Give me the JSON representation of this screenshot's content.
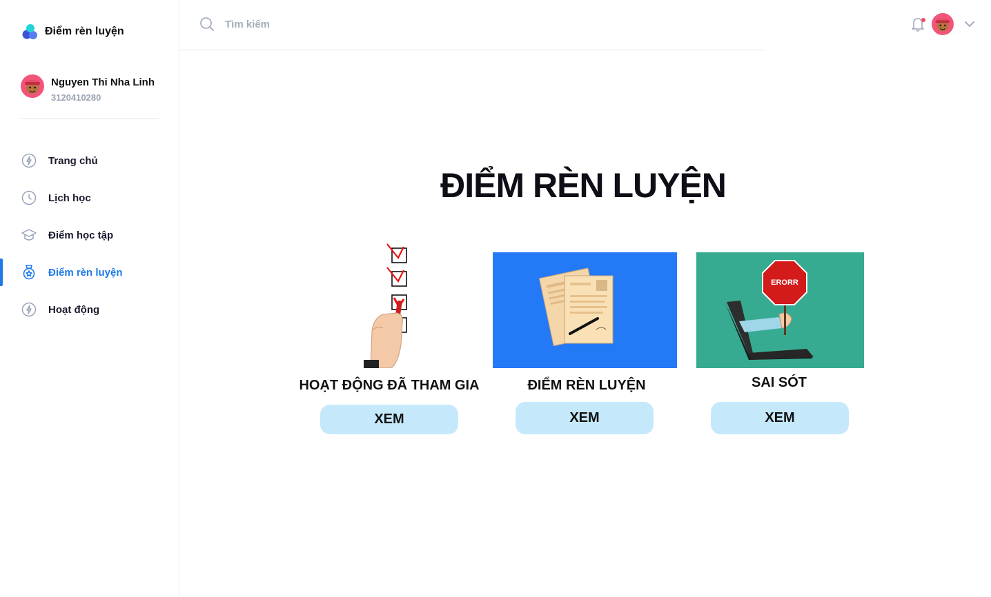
{
  "brand": {
    "title": "Điểm rèn luyện"
  },
  "user": {
    "name": "Nguyen Thi Nha Linh",
    "student_id": "3120410280"
  },
  "nav": {
    "items": [
      {
        "label": "Trang chủ",
        "icon": "lightning-circle-icon",
        "active": false
      },
      {
        "label": "Lịch học",
        "icon": "clock-icon",
        "active": false
      },
      {
        "label": "Điểm học tập",
        "icon": "graduation-cap-icon",
        "active": false
      },
      {
        "label": "Điểm rèn luyện",
        "icon": "badge-star-icon",
        "active": true
      },
      {
        "label": "Hoạt động",
        "icon": "lightning-circle-icon",
        "active": false
      }
    ]
  },
  "search": {
    "placeholder": "Tìm kiếm",
    "value": ""
  },
  "header": {
    "icons": [
      "bell-icon",
      "avatar",
      "chevron-down-icon"
    ]
  },
  "main": {
    "title": "ĐIỂM RÈN LUYỆN",
    "cards": [
      {
        "title": "HOẠT ĐỘNG ĐÃ THAM GIA",
        "button": "XEM",
        "image": "checklist-hand-illustration"
      },
      {
        "title": "ĐIỂM RÈN LUYỆN",
        "button": "XEM",
        "image": "documents-pen-illustration"
      },
      {
        "title": "SAI SÓT",
        "button": "XEM",
        "image": "laptop-error-sign-illustration",
        "image_text": "ERORR"
      }
    ]
  },
  "colors": {
    "accent": "#1f7ae8",
    "button_bg": "#c5e9fb",
    "card2_bg": "#2479f7",
    "card3_bg": "#36ab91"
  }
}
